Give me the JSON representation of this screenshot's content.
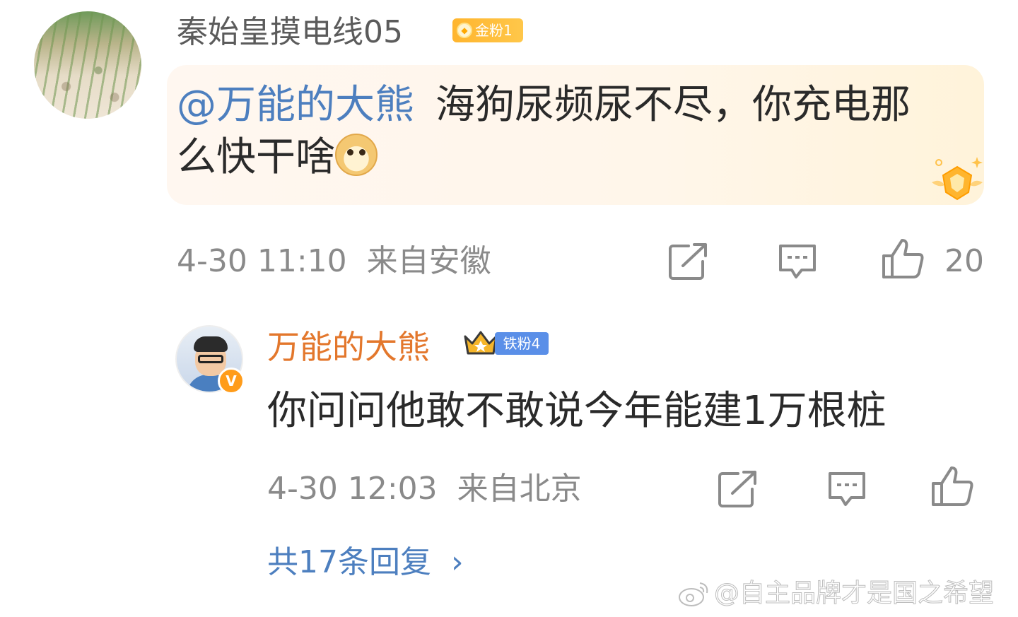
{
  "comment": {
    "username": "秦始皇摸电线05",
    "fan_badge": "金粉1",
    "mention": "@万能的大熊",
    "text_line1": "海狗尿频尿不尽，你充电那",
    "text_line2": "么快干啥",
    "emoji": "doge-emoji",
    "timestamp": "4-30 11:10",
    "location": "来自安徽",
    "like_count": "20"
  },
  "reply": {
    "username": "万能的大熊",
    "fan_badge": "铁粉4",
    "verified_mark": "V",
    "text": "你问问他敢不敢说今年能建1万根桩",
    "timestamp": "4-30 12:03",
    "location": "来自北京"
  },
  "more_replies": {
    "label": "共17条回复",
    "chevron": "›"
  },
  "watermark": {
    "text": "@自主品牌才是国之希望"
  },
  "colors": {
    "mention": "#4d7fbf",
    "reply_username": "#e3772c",
    "meta_gray": "#8a8a8a",
    "gold_badge": "#ffb52e",
    "iron_badge": "#5a8fe8"
  },
  "icons": [
    "share-icon",
    "comment-icon",
    "like-icon",
    "chevron-right-icon",
    "weibo-logo-icon"
  ]
}
